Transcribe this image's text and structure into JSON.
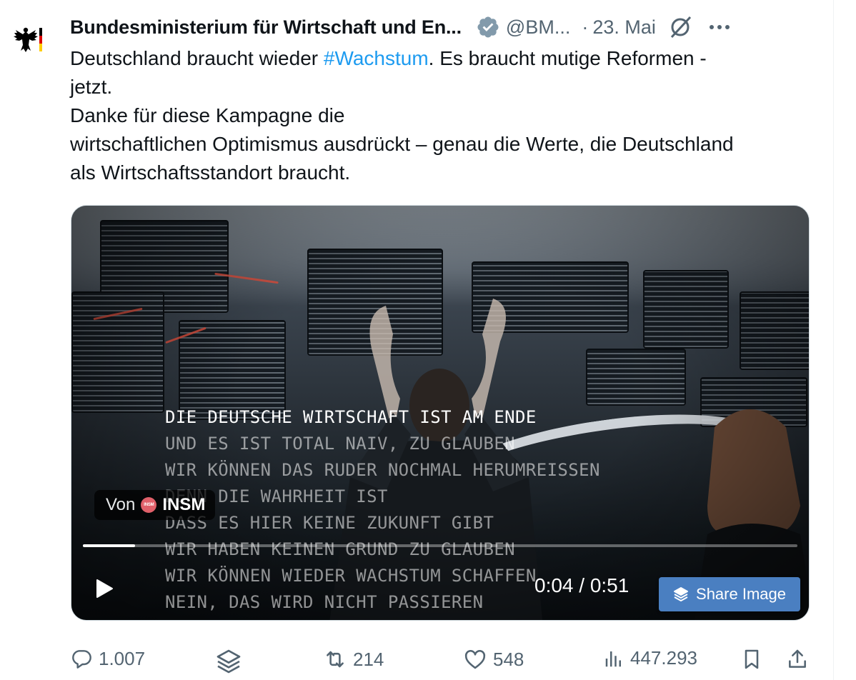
{
  "tweet": {
    "author_name": "Bundesministerium für Wirtschaft und En...",
    "handle": "@BM...",
    "separator": "·",
    "date": "23. Mai",
    "text_lines": [
      {
        "before": "Deutschland braucht wieder ",
        "hashtag": "#Wachstum",
        "after": ". Es braucht mutige Reformen -"
      },
      {
        "text": "jetzt."
      },
      {
        "text": "Danke für diese Kampagne die"
      },
      {
        "text": "wirtschaftlichen Optimismus ausdrückt – genau die Werte, die Deutschland"
      },
      {
        "text": "als Wirtschaftsstandort braucht."
      }
    ]
  },
  "video": {
    "captions": [
      "DIE DEUTSCHE WIRTSCHAFT IST AM ENDE",
      "UND ES IST TOTAL NAIV, ZU GLAUBEN",
      "WIR KÖNNEN DAS RUDER NOCHMAL HERUMREISSEN",
      "DENN DIE WAHRHEIT IST",
      "DASS ES HIER KEINE ZUKUNFT GIBT",
      "WIR HABEN KEINEN GRUND ZU GLAUBEN",
      "WIR KÖNNEN WIEDER WACHSTUM SCHAFFEN",
      "NEIN, DAS WIRD NICHT PASSIEREN"
    ],
    "source_prefix": "Von",
    "source_logo_text": "INSM",
    "source_name": "INSM",
    "time": "0:04 / 0:51",
    "progress_fraction": 0.073,
    "share_image_label": "Share Image"
  },
  "actions": {
    "replies": "1.007",
    "reposts": "214",
    "likes": "548",
    "views": "447.293"
  },
  "colors": {
    "link": "#1d9bf0",
    "secondary_text": "#536471",
    "verified_badge": "#829aab",
    "share_button": "#4a7fc1"
  }
}
